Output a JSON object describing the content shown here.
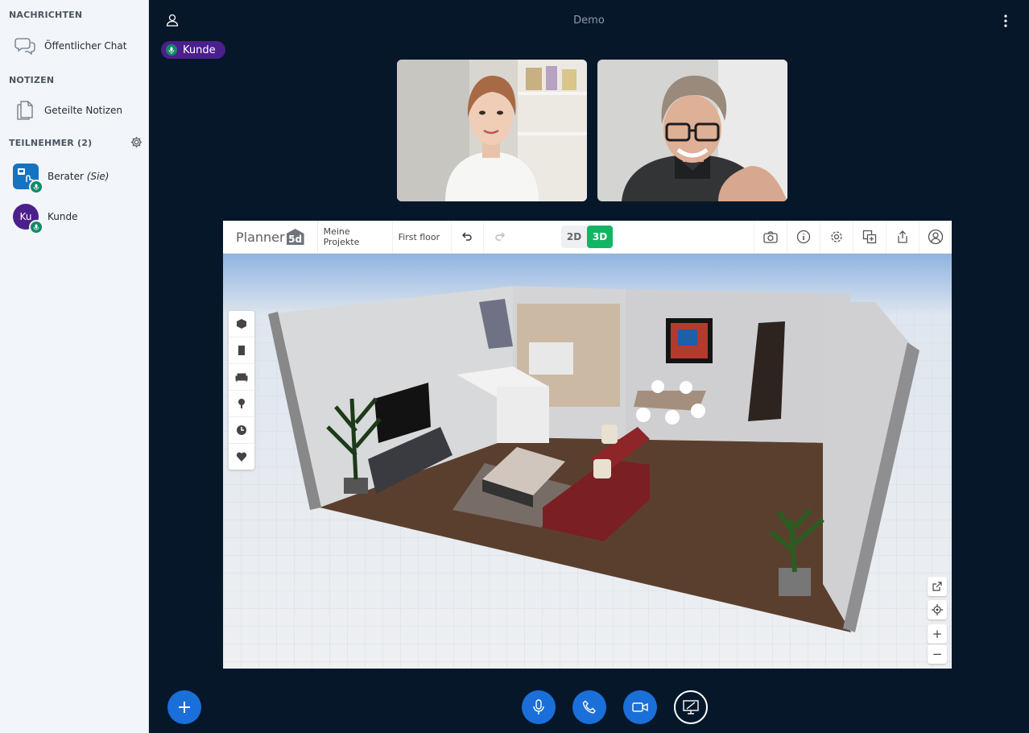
{
  "sidebar": {
    "messages_title": "NACHRICHTEN",
    "public_chat": "Öffentlicher Chat",
    "notes_title": "NOTIZEN",
    "shared_notes": "Geteilte Notizen",
    "participants_title": "TEILNEHMER (2)",
    "users": [
      {
        "name": "Berater",
        "suffix": "(Sie)",
        "avatar": "",
        "color": "#1573c4"
      },
      {
        "name": "Kunde",
        "suffix": "",
        "avatar": "Ku",
        "color": "#4b1f8c"
      }
    ]
  },
  "header": {
    "title": "Demo",
    "talking_indicator": "Kunde"
  },
  "planner": {
    "logo_text": "Planner",
    "logo_badge": "5d",
    "projects": "Meine Projekte",
    "floor": "First floor",
    "view_2d": "2D",
    "view_3d": "3D",
    "zoom_in": "+",
    "zoom_out": "−"
  },
  "colors": {
    "accent": "#1a6fd8",
    "sidebar_bg": "#f2f5f9",
    "main_bg": "#06172a",
    "talking": "#4b1f8c",
    "planner_active": "#12b563"
  }
}
